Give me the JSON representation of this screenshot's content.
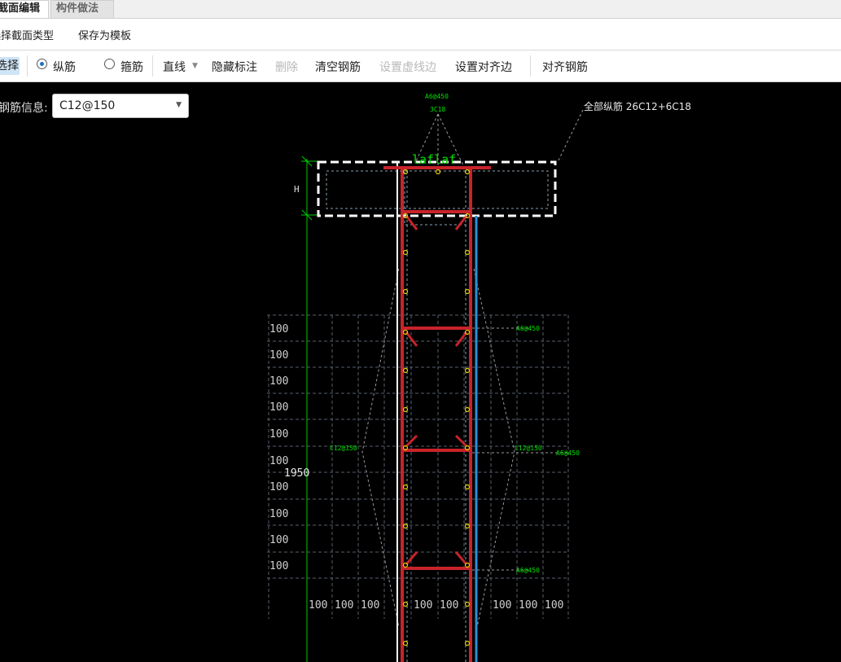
{
  "tabs": [
    {
      "label": "截面编辑",
      "active": true
    },
    {
      "label": "构件做法",
      "active": false
    }
  ],
  "menu": {
    "select_type": "选择截面类型",
    "save_template": "保存为模板"
  },
  "toolbar": {
    "select": "选择",
    "longitudinal": "纵筋",
    "stirrup": "箍筋",
    "line": "直线",
    "hide_annotation": "隐藏标注",
    "delete": "删除",
    "clear_rebar": "清空钢筋",
    "set_dashed_edge": "设置虚线边",
    "set_align_edge": "设置对齐边",
    "align_rebar": "对齐钢筋"
  },
  "rebar_info": {
    "label": "钢筋信息:",
    "value": "C12@150"
  },
  "drawing": {
    "total_rebar_label": "全部纵筋  26C12+6C18",
    "top_label_1": "A6@450",
    "top_label_2": "3C18",
    "laflaf": "laflaf",
    "h_label": "H",
    "height_dim": "1950",
    "grid_label": "100",
    "left_rebar": "C12@150",
    "right_rebar": "C12@150",
    "a6_labels": [
      "A6@450",
      "A6@450",
      "A6@450"
    ]
  },
  "colors": {
    "red_rebar": "#c8232a",
    "blue_line": "#2a8fd8",
    "green": "#00dd00",
    "dim_grey": "#6a7a8a"
  }
}
